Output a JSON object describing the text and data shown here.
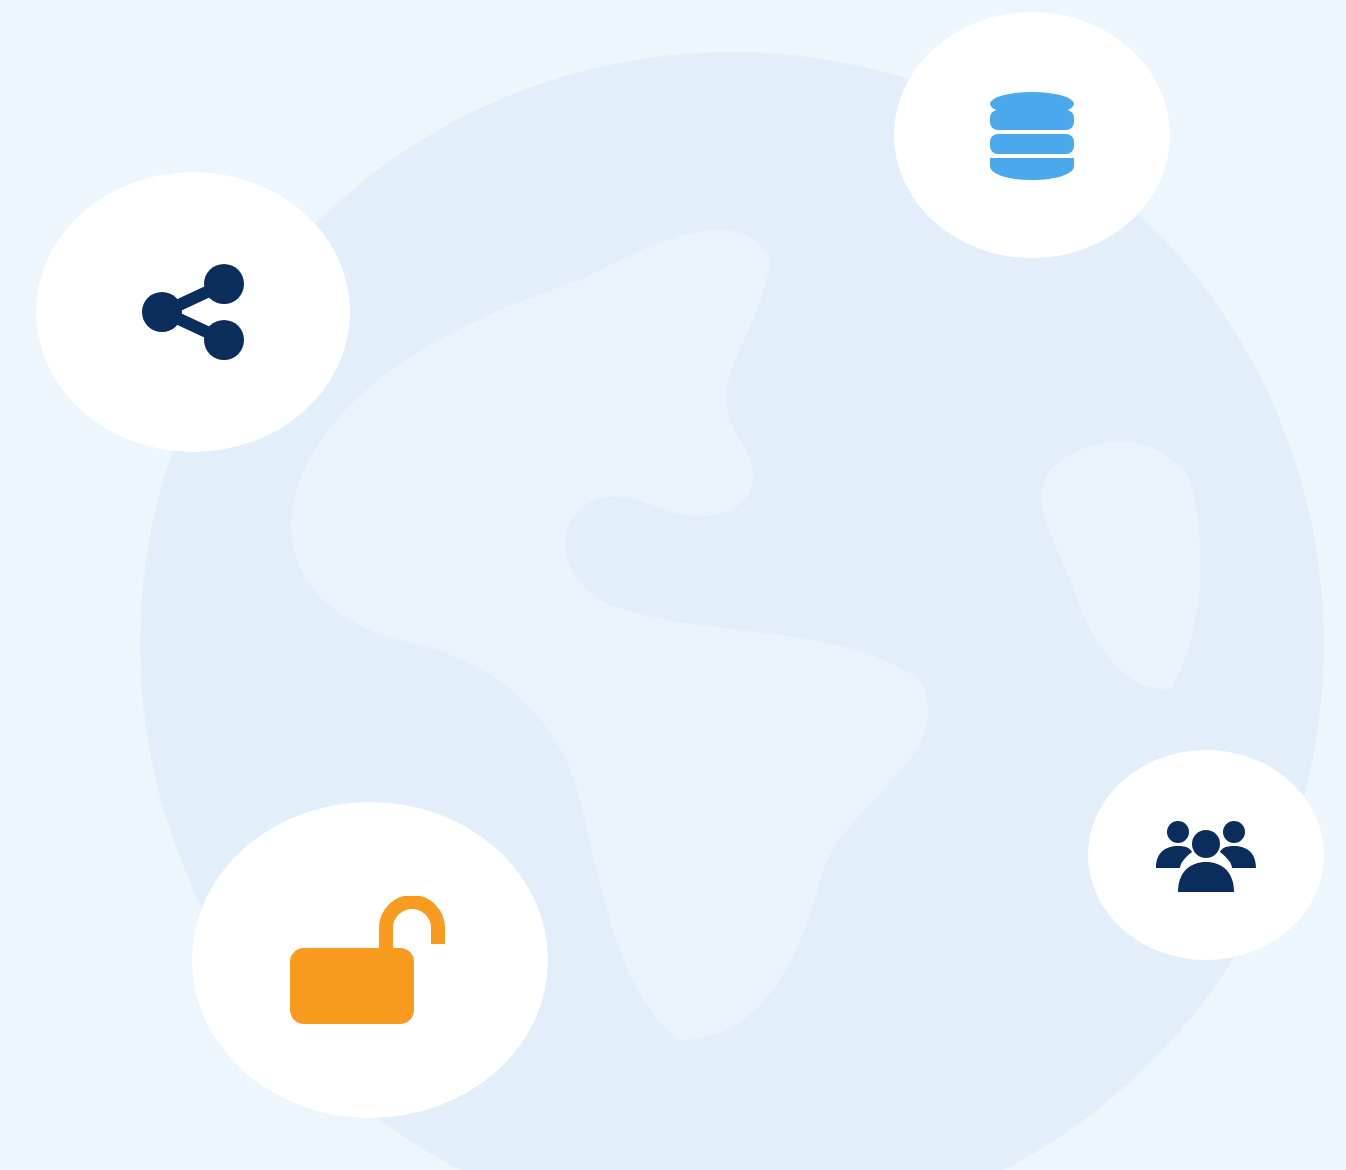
{
  "badges": [
    {
      "kind": "share",
      "color": "#0b2d5b"
    },
    {
      "kind": "database",
      "color": "#4aa8ec"
    },
    {
      "kind": "users",
      "color": "#0b2d5b"
    },
    {
      "kind": "lock",
      "color": "#f89b1f"
    }
  ]
}
